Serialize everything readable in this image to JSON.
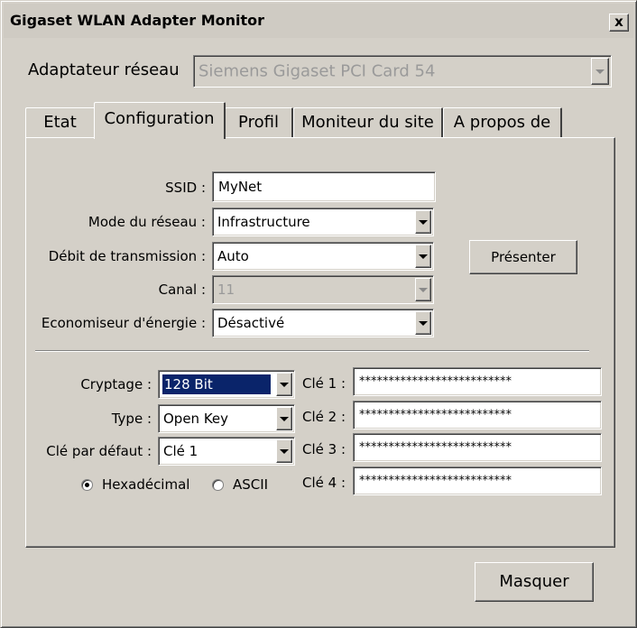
{
  "window": {
    "title": "Gigaset WLAN Adapter Monitor",
    "close_label": "x"
  },
  "adapter": {
    "label": "Adaptateur réseau",
    "value": "Siemens Gigaset PCI Card 54"
  },
  "tabs": [
    {
      "label": "Etat",
      "active": false
    },
    {
      "label": "Configuration",
      "active": true
    },
    {
      "label": "Profil",
      "active": false
    },
    {
      "label": "Moniteur du site",
      "active": false
    },
    {
      "label": "A propos de",
      "active": false
    }
  ],
  "config": {
    "ssid_label": "SSID :",
    "ssid_value": "MyNet",
    "mode_label": "Mode du réseau :",
    "mode_value": "Infrastructure",
    "rate_label": "Débit de transmission :",
    "rate_value": "Auto",
    "channel_label": "Canal :",
    "channel_value": "11",
    "power_label": "Economiseur d'énergie :",
    "power_value": "Désactivé",
    "present_button": "Présenter"
  },
  "encryption": {
    "cipher_label": "Cryptage :",
    "cipher_value": "128 Bit",
    "type_label": "Type :",
    "type_value": "Open Key",
    "default_key_label": "Clé par défaut :",
    "default_key_value": "Clé 1",
    "hex_label": "Hexadécimal",
    "ascii_label": "ASCII",
    "hex_selected": true,
    "keys": [
      {
        "label": "Clé 1 :",
        "value": "**************************"
      },
      {
        "label": "Clé 2 :",
        "value": "**************************"
      },
      {
        "label": "Clé 3 :",
        "value": "**************************"
      },
      {
        "label": "Clé 4 :",
        "value": "**************************"
      }
    ]
  },
  "footer": {
    "hide_button": "Masquer"
  }
}
